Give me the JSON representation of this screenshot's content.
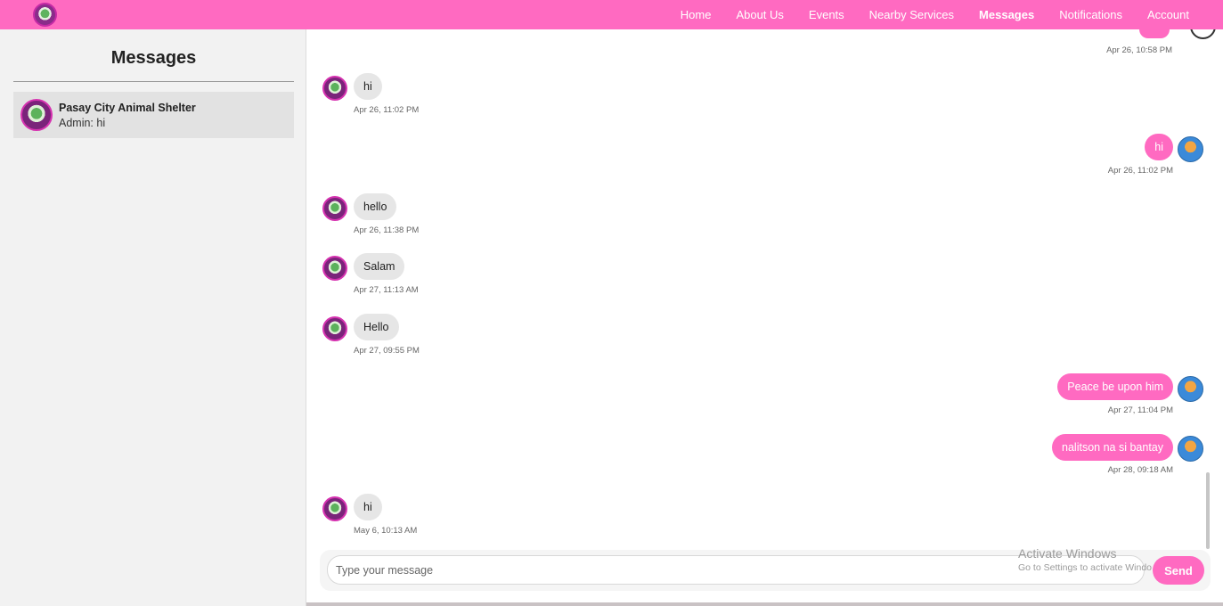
{
  "nav": {
    "links": [
      "Home",
      "About Us",
      "Events",
      "Nearby Services",
      "Messages",
      "Notifications",
      "Account"
    ],
    "active": "Messages"
  },
  "sidebar": {
    "title": "Messages",
    "conversations": [
      {
        "name": "Pasay City Animal Shelter",
        "preview": "Admin: hi"
      }
    ]
  },
  "messages": [
    {
      "direction": "out",
      "text": "",
      "time": "Apr 26, 10:58 PM"
    },
    {
      "direction": "in",
      "text": "hi",
      "time": "Apr 26, 11:02 PM"
    },
    {
      "direction": "out",
      "text": "hi",
      "time": "Apr 26, 11:02 PM"
    },
    {
      "direction": "in",
      "text": "hello",
      "time": "Apr 26, 11:38 PM"
    },
    {
      "direction": "in",
      "text": "Salam",
      "time": "Apr 27, 11:13 AM"
    },
    {
      "direction": "in",
      "text": "Hello",
      "time": "Apr 27, 09:55 PM"
    },
    {
      "direction": "out",
      "text": "Peace be upon him",
      "time": "Apr 27, 11:04 PM"
    },
    {
      "direction": "out",
      "text": "nalitson na si bantay",
      "time": "Apr 28, 09:18 AM"
    },
    {
      "direction": "in",
      "text": "hi",
      "time": "May 6, 10:13 AM"
    }
  ],
  "composer": {
    "placeholder": "Type your message",
    "send_label": "Send"
  },
  "watermark": {
    "title": "Activate Windows",
    "subtitle": "Go to Settings to activate Windows."
  },
  "colors": {
    "accent": "#ff6ac1",
    "incoming_bubble": "#e6e6e6"
  }
}
